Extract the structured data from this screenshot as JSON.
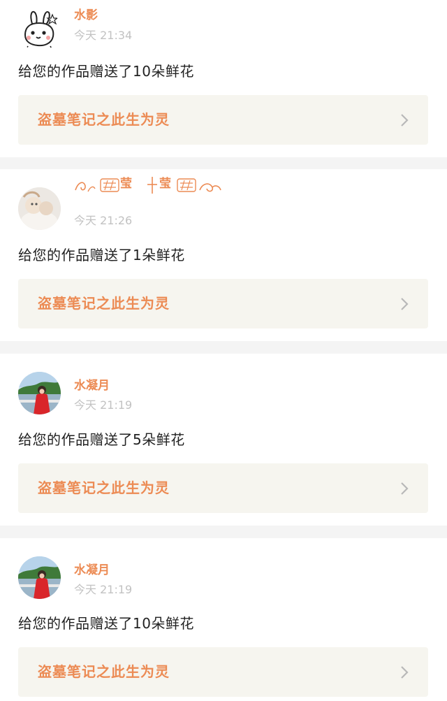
{
  "work_title": "盗墓笔记之此生为灵",
  "accent_color": "#ec8b54",
  "notifications": [
    {
      "username": "水影",
      "avatar_icon": "cartoon-rabbit-avatar",
      "time": "今天 21:34",
      "message": "给您的作品赠送了10朵鲜花",
      "work_title": "盗墓笔记之此生为灵"
    },
    {
      "username": "莹十莹",
      "username_style": "decorative-ornament",
      "avatar_icon": "plush-toy-photo-avatar",
      "time": "今天 21:26",
      "message": "给您的作品赠送了1朵鲜花",
      "work_title": "盗墓笔记之此生为灵"
    },
    {
      "username": "水凝月",
      "avatar_icon": "red-dress-girl-photo-avatar",
      "time": "今天 21:19",
      "message": "给您的作品赠送了5朵鲜花",
      "work_title": "盗墓笔记之此生为灵"
    },
    {
      "username": "水凝月",
      "avatar_icon": "red-dress-girl-photo-avatar",
      "time": "今天 21:19",
      "message": "给您的作品赠送了10朵鲜花",
      "work_title": "盗墓笔记之此生为灵"
    }
  ]
}
